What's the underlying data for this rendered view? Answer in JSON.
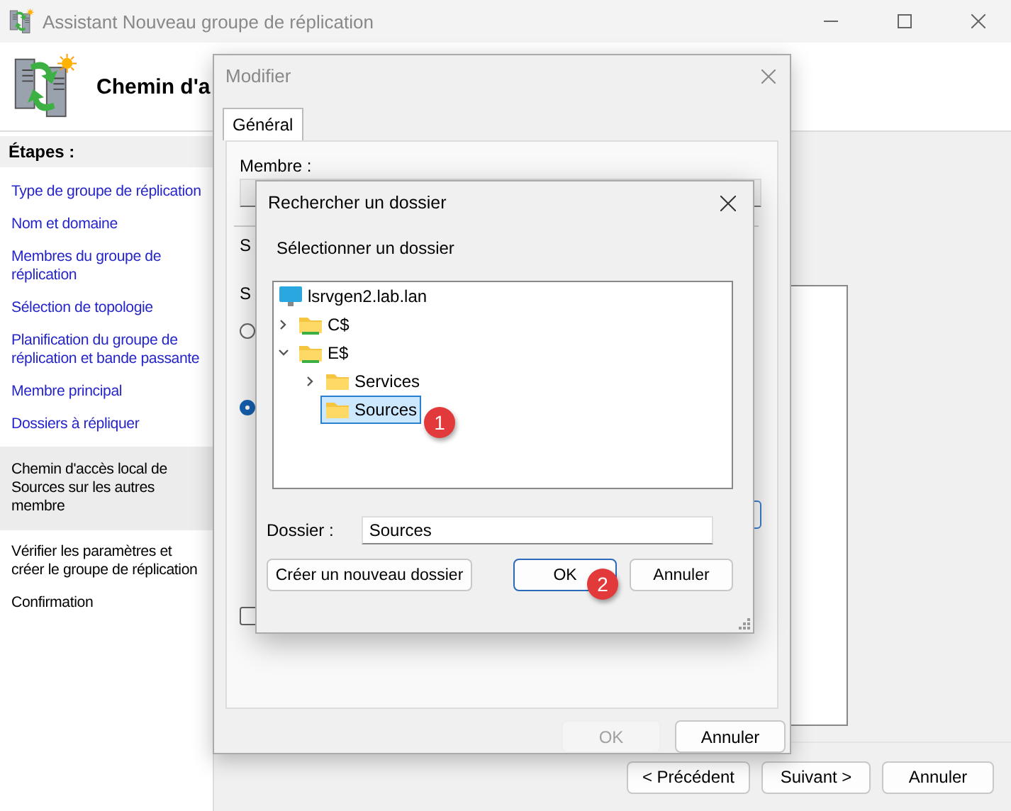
{
  "window": {
    "title": "Assistant Nouveau groupe de réplication"
  },
  "header": {
    "title": "Chemin d'a"
  },
  "steps": {
    "heading": "Étapes :",
    "items": [
      {
        "label": "Type de groupe de réplication",
        "visited": true,
        "selected": false
      },
      {
        "label": "Nom et domaine",
        "visited": true,
        "selected": false
      },
      {
        "label": "Membres du groupe de réplication",
        "visited": true,
        "selected": false
      },
      {
        "label": "Sélection de topologie",
        "visited": true,
        "selected": false
      },
      {
        "label": "Planification du groupe de réplication et bande passante",
        "visited": true,
        "selected": false
      },
      {
        "label": "Membre principal",
        "visited": true,
        "selected": false
      },
      {
        "label": "Dossiers à répliquer",
        "visited": true,
        "selected": false
      },
      {
        "label": "Chemin d'accès local de Sources sur les autres membre",
        "visited": false,
        "selected": true
      },
      {
        "label": "Vérifier les paramètres et créer le groupe de réplication",
        "visited": false,
        "selected": false
      },
      {
        "label": "Confirmation",
        "visited": false,
        "selected": false
      }
    ]
  },
  "wizard_buttons": [
    {
      "label": "< Précédent",
      "disabled": false
    },
    {
      "label": "Suivant >",
      "disabled": false
    },
    {
      "label": "Annuler",
      "disabled": false
    }
  ],
  "modify_dialog": {
    "title": "Modifier",
    "tabs": [
      {
        "label": "Général",
        "selected": true
      }
    ],
    "member_label": "Membre :",
    "fragments": [
      "S",
      "S"
    ],
    "radios": [
      {
        "selected": false
      },
      {
        "selected": true
      }
    ],
    "checkbox": {
      "checked": false
    },
    "buttons": [
      {
        "label": "OK",
        "disabled": true
      },
      {
        "label": "Annuler",
        "disabled": false
      }
    ]
  },
  "browse_dialog": {
    "title": "Rechercher un dossier",
    "prompt": "Sélectionner un dossier",
    "tree": [
      {
        "label": "lsrvgen2.lab.lan",
        "kind": "computer",
        "selected": false,
        "children": [
          {
            "label": "C$",
            "kind": "drive",
            "expandable": true,
            "expanded": false,
            "selected": false
          },
          {
            "label": "E$",
            "kind": "drive",
            "expandable": true,
            "expanded": true,
            "selected": false,
            "children": [
              {
                "label": "Services",
                "kind": "folder",
                "expandable": true,
                "expanded": false,
                "selected": false
              },
              {
                "label": "Sources",
                "kind": "folder",
                "selected": true
              }
            ]
          }
        ]
      }
    ],
    "folder_label": "Dossier :",
    "folder_value": "Sources",
    "buttons": [
      {
        "label": "Créer un nouveau dossier",
        "focused": false
      },
      {
        "label": "OK",
        "focused": true
      },
      {
        "label": "Annuler",
        "focused": false
      }
    ]
  },
  "callouts": [
    {
      "label": "1"
    },
    {
      "label": "2"
    }
  ]
}
